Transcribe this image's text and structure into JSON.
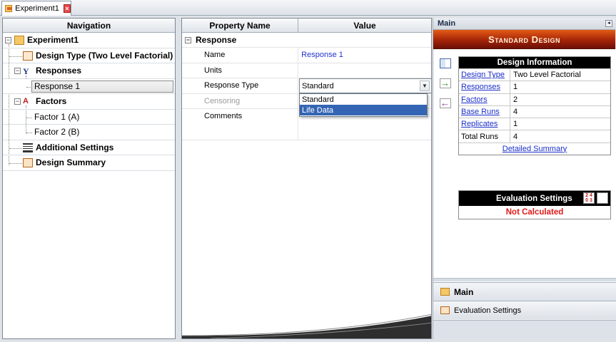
{
  "tab": {
    "title": "Experiment1",
    "close_icon": "close-icon"
  },
  "navigation": {
    "header": "Navigation",
    "items": [
      {
        "label": "Experiment1",
        "icon": "experiment-folio-icon"
      },
      {
        "label": "Design Type (Two Level Factorial)",
        "icon": "design-type-icon"
      },
      {
        "label": "Responses",
        "icon": "responses-icon"
      },
      {
        "label": "Response 1",
        "selected": true
      },
      {
        "label": "Factors",
        "icon": "factors-icon"
      },
      {
        "label": "Factor 1 (A)"
      },
      {
        "label": "Factor 2 (B)"
      },
      {
        "label": "Additional Settings",
        "icon": "settings-list-icon"
      },
      {
        "label": "Design Summary",
        "icon": "design-summary-icon"
      }
    ]
  },
  "property_grid": {
    "col_name": "Property Name",
    "col_value": "Value",
    "category": "Response",
    "rows": [
      {
        "name": "Name",
        "value": "Response 1"
      },
      {
        "name": "Units",
        "value": ""
      },
      {
        "name": "Response Type",
        "value": "Standard"
      },
      {
        "name": "Censoring",
        "value": ""
      },
      {
        "name": "Comments",
        "value": ""
      }
    ],
    "dropdown_options": [
      "Standard",
      "Life Data"
    ],
    "dropdown_highlighted": "Life Data"
  },
  "right_panel": {
    "header": "Main",
    "banner": "Standard Design",
    "design_info": {
      "title": "Design Information",
      "rows": [
        {
          "key": "Design Type",
          "value": "Two Level Factorial",
          "link": true
        },
        {
          "key": "Responses",
          "value": "1",
          "link": true
        },
        {
          "key": "Factors",
          "value": "2",
          "link": true
        },
        {
          "key": "Base Runs",
          "value": "4",
          "link": true
        },
        {
          "key": "Replicates",
          "value": "1",
          "link": true
        },
        {
          "key": "Total Runs",
          "value": "4",
          "link": false
        }
      ],
      "footer_link": "Detailed Summary"
    },
    "evaluation": {
      "title": "Evaluation Settings",
      "status": "Not Calculated"
    },
    "accordion": {
      "main": "Main",
      "evaluation": "Evaluation Settings"
    }
  },
  "colors": {
    "banner_top": "#e45c14",
    "banner_bottom": "#6b0f06",
    "link": "#1b2fc9",
    "status_red": "#e01818",
    "dropdown_highlight": "#3465b4"
  }
}
